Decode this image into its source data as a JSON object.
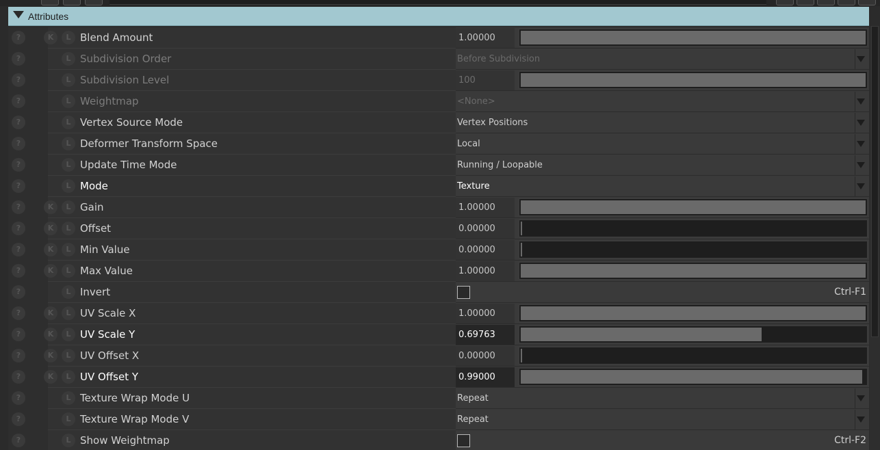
{
  "section": {
    "title": "Attributes"
  },
  "icons": {
    "help": "?",
    "key": "K",
    "lock": "L"
  },
  "rows": [
    {
      "label": "Blend Amount",
      "type": "number",
      "value": "1.00000",
      "fill": 1.0,
      "key": true,
      "disabled": false,
      "active": false
    },
    {
      "label": "Subdivision Order",
      "type": "dropdown",
      "value": "Before Subdivision",
      "key": false,
      "disabled": true
    },
    {
      "label": "Subdivision Level",
      "type": "number",
      "value": "100",
      "fill": 1.0,
      "key": false,
      "disabled": true
    },
    {
      "label": "Weightmap",
      "type": "dropdown",
      "value": "<None>",
      "key": false,
      "disabled": true
    },
    {
      "label": "Vertex Source Mode",
      "type": "dropdown",
      "value": "Vertex Positions",
      "key": false,
      "disabled": false
    },
    {
      "label": "Deformer Transform Space",
      "type": "dropdown",
      "value": "Local",
      "key": false,
      "disabled": false
    },
    {
      "label": "Update Time Mode",
      "type": "dropdown",
      "value": "Running / Loopable",
      "key": false,
      "disabled": false
    },
    {
      "label": "Mode",
      "type": "dropdown",
      "value": "Texture",
      "key": false,
      "disabled": false,
      "active": true
    },
    {
      "label": "Gain",
      "type": "number",
      "value": "1.00000",
      "fill": 1.0,
      "key": true,
      "disabled": false
    },
    {
      "label": "Offset",
      "type": "number",
      "value": "0.00000",
      "fill": 0.0,
      "key": true,
      "disabled": false
    },
    {
      "label": "Min Value",
      "type": "number",
      "value": "0.00000",
      "fill": 0.0,
      "key": true,
      "disabled": false
    },
    {
      "label": "Max Value",
      "type": "number",
      "value": "1.00000",
      "fill": 1.0,
      "key": true,
      "disabled": false
    },
    {
      "label": "Invert",
      "type": "checkbox",
      "checked": false,
      "shortcut": "Ctrl-F1",
      "key": false,
      "disabled": false
    },
    {
      "label": "UV Scale X",
      "type": "number",
      "value": "1.00000",
      "fill": 1.0,
      "key": true,
      "disabled": false
    },
    {
      "label": "UV Scale Y",
      "type": "number",
      "value": "0.69763",
      "fill": 0.69763,
      "key": true,
      "disabled": false,
      "active": true
    },
    {
      "label": "UV Offset X",
      "type": "number",
      "value": "0.00000",
      "fill": 0.0,
      "key": true,
      "disabled": false
    },
    {
      "label": "UV Offset Y",
      "type": "number",
      "value": "0.99000",
      "fill": 0.99,
      "key": true,
      "disabled": false,
      "active": true
    },
    {
      "label": "Texture Wrap Mode U",
      "type": "dropdown",
      "value": "Repeat",
      "key": false,
      "disabled": false
    },
    {
      "label": "Texture Wrap Mode V",
      "type": "dropdown",
      "value": "Repeat",
      "key": false,
      "disabled": false
    },
    {
      "label": "Show Weightmap",
      "type": "checkbox",
      "checked": false,
      "shortcut": "Ctrl-F2",
      "key": false,
      "disabled": false
    }
  ]
}
